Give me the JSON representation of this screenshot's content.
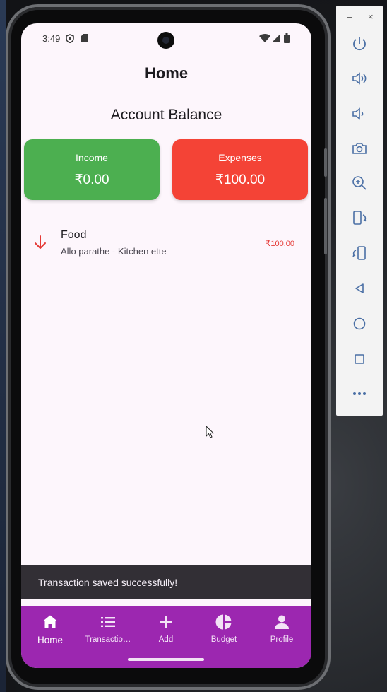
{
  "status_bar": {
    "time": "3:49"
  },
  "page": {
    "title": "Home",
    "balance_heading": "Account Balance"
  },
  "cards": {
    "income": {
      "label": "Income",
      "value": "₹0.00",
      "color": "#4caf50"
    },
    "expenses": {
      "label": "Expenses",
      "value": "₹100.00",
      "color": "#f44336"
    }
  },
  "transactions": [
    {
      "icon": "arrow-down-icon",
      "title": "Food",
      "subtitle": "Allo parathe - Kitchen ette",
      "amount": "₹100.00",
      "type": "expense"
    }
  ],
  "snackbar": {
    "message": "Transaction saved successfully!"
  },
  "bottom_nav": {
    "color": "#9c27b0",
    "items": [
      {
        "label": "Home",
        "icon": "home-icon",
        "active": true
      },
      {
        "label": "Transactio…",
        "icon": "list-icon",
        "active": false
      },
      {
        "label": "Add",
        "icon": "plus-icon",
        "active": false
      },
      {
        "label": "Budget",
        "icon": "pie-chart-icon",
        "active": false
      },
      {
        "label": "Profile",
        "icon": "person-icon",
        "active": false
      }
    ]
  },
  "emulator_panel": {
    "window_controls": {
      "minimize": "–",
      "close": "×"
    },
    "buttons": [
      "power-icon",
      "volume-up-icon",
      "volume-down-icon",
      "camera-icon",
      "zoom-in-icon",
      "rotate-left-icon",
      "rotate-right-icon",
      "back-icon",
      "home-circle-icon",
      "overview-icon",
      "more-icon"
    ]
  }
}
